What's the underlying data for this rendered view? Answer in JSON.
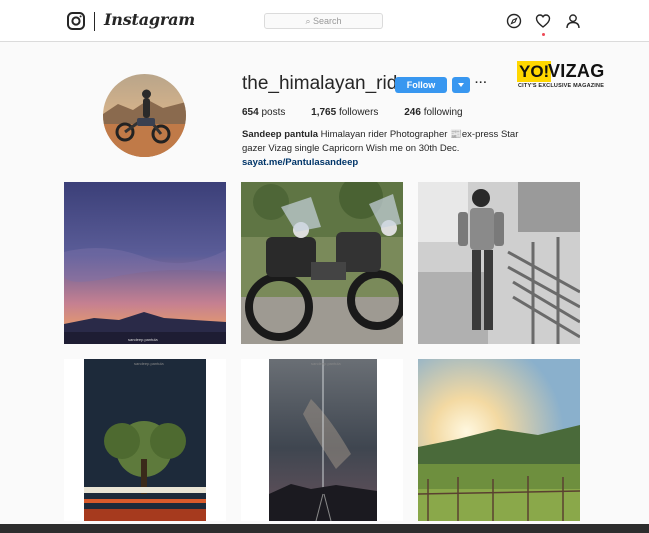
{
  "header": {
    "logo_word": "Instagram",
    "search_placeholder": "Search",
    "nav_icons": [
      "compass-icon",
      "heart-icon",
      "user-icon"
    ]
  },
  "profile": {
    "username": "the_himalayan_rider",
    "follow_label": "Follow",
    "more_label": "···",
    "stats": {
      "posts_count": "654",
      "posts_label": "posts",
      "followers_count": "1,765",
      "followers_label": "followers",
      "following_count": "246",
      "following_label": "following"
    },
    "bio": {
      "name": "Sandeep pantula",
      "text_1": " Himalayan rider Photographer ",
      "text_2": "ex-press Star gazer Vizag single Capricorn Wish me on 30th Dec. ",
      "link": "sayat.me/Pantulasandeep"
    }
  },
  "brand": {
    "yo": "YO!",
    "vizag": "VIZAG",
    "tagline": "CITY'S EXCLUSIVE MAGAZINE"
  },
  "posts": {
    "watermark_1": "sandeep.pantula",
    "watermark_4": "sandeep.pantula",
    "watermark_5": "sandeep.pantula"
  },
  "colors": {
    "accent": "#3897f0",
    "link": "#003569",
    "brand_yellow": "#ffd700"
  }
}
